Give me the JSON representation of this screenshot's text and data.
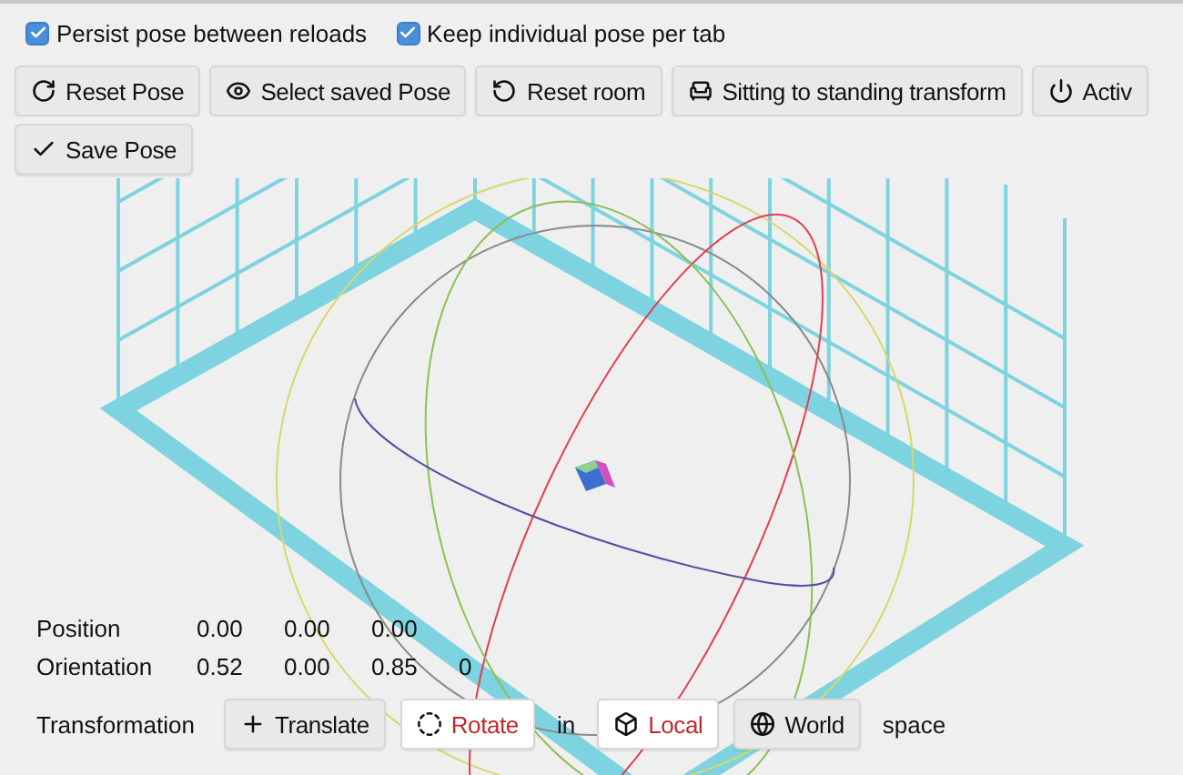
{
  "options": [
    {
      "label": "Persist pose between reloads",
      "checked": true
    },
    {
      "label": "Keep individual pose per tab",
      "checked": true
    }
  ],
  "actions": [
    {
      "label": "Reset Pose",
      "kind": "reset"
    },
    {
      "label": "Select saved Pose",
      "kind": "eye"
    },
    {
      "label": "Reset room",
      "kind": "room"
    },
    {
      "label": "Sitting to standing transform",
      "kind": "seat"
    },
    {
      "label": "Activ",
      "kind": "power"
    },
    {
      "label": "Save Pose",
      "kind": "check"
    }
  ],
  "position": {
    "label": "Position",
    "values": [
      "0.00",
      "0.00",
      "0.00"
    ]
  },
  "orientation": {
    "label": "Orientation",
    "values": [
      "0.52",
      "0.00",
      "0.85",
      "0"
    ]
  },
  "transformation": {
    "label": "Transformation",
    "modes": [
      {
        "label": "Translate",
        "kind": "translate",
        "selected": false
      },
      {
        "label": "Rotate",
        "kind": "rotate",
        "selected": true
      }
    ],
    "connector": "in",
    "spaces": [
      {
        "label": "Local",
        "kind": "local",
        "selected": true
      },
      {
        "label": "World",
        "kind": "world",
        "selected": false
      }
    ],
    "suffix": "space"
  }
}
